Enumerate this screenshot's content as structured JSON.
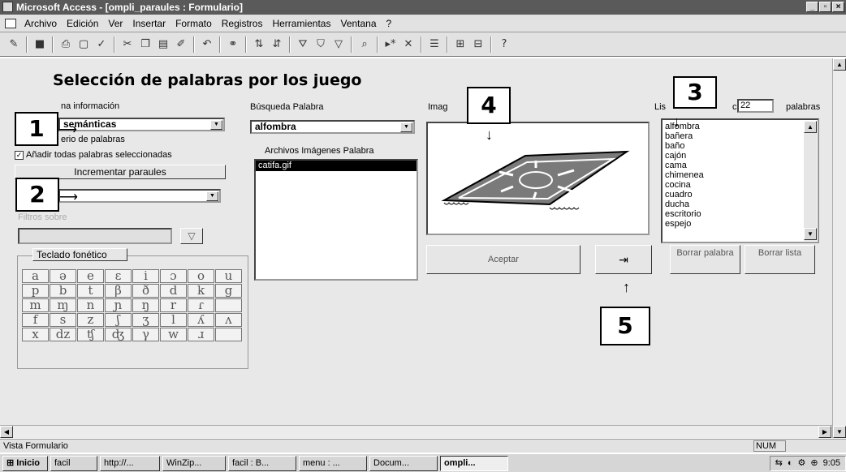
{
  "window": {
    "title": "Microsoft Access - [ompli_paraules : Formulario]",
    "min": "_",
    "max": "▫",
    "close": "×"
  },
  "menu": [
    "Archivo",
    "Edición",
    "Ver",
    "Insertar",
    "Formato",
    "Registros",
    "Herramientas",
    "Ventana",
    "?"
  ],
  "form": {
    "title": "Selección de palabras por los juego",
    "info_label": "na información",
    "semantic_value": "semánticas",
    "criterio_label": "erio de palabras",
    "add_all_label": "Añadir todas palabras seleccionadas",
    "incrementar_label": "Incrementar paraules",
    "filtros_label": "Filtros sobre",
    "teclado_label": "Teclado fonético",
    "busqueda_label": "Búsqueda Palabra",
    "busqueda_value": "alfombra",
    "archivos_label": "Archivos Imágenes Palabra",
    "archivos_items": [
      "catifa.gif"
    ],
    "imagen_label": "Imag",
    "lista_label": "Lis",
    "lista_label2": "c",
    "lista_count": "22",
    "palabras_label": "palabras",
    "words": [
      "alfombra",
      "bañera",
      "baño",
      "cajón",
      "cama",
      "chimenea",
      "cocina",
      "cuadro",
      "ducha",
      "escritorio",
      "espejo"
    ],
    "aceptar_label": "Aceptar",
    "exit_icon": "⇥",
    "borrar_palabra_label": "Borrar palabra",
    "borrar_lista_label": "Borrar lista"
  },
  "phonetic": [
    "a",
    "ə",
    "e",
    "ɛ",
    "i",
    "ɔ",
    "o",
    "u",
    "p",
    "b",
    "t",
    "β",
    "ð",
    "d",
    "k",
    "g",
    "m",
    "ɱ",
    "n",
    "ɲ",
    "ŋ",
    "r",
    "ɾ",
    "",
    "f",
    "s",
    "z",
    "ʃ",
    "ʒ",
    "l",
    "ʎ",
    "ʌ",
    "x",
    "dz",
    "ʧ",
    "ʤ",
    "γ",
    "w",
    "ɹ",
    ""
  ],
  "callouts": [
    "1",
    "2",
    "3",
    "4",
    "5"
  ],
  "status": {
    "text": "Vista Formulario",
    "num": "NUM"
  },
  "taskbar": {
    "start": "Inicio",
    "tasks": [
      "facil",
      "http://...",
      "WinZip...",
      "facil : B...",
      "menu : ...",
      "Docum...",
      "ompli..."
    ],
    "clock": "9:05"
  }
}
